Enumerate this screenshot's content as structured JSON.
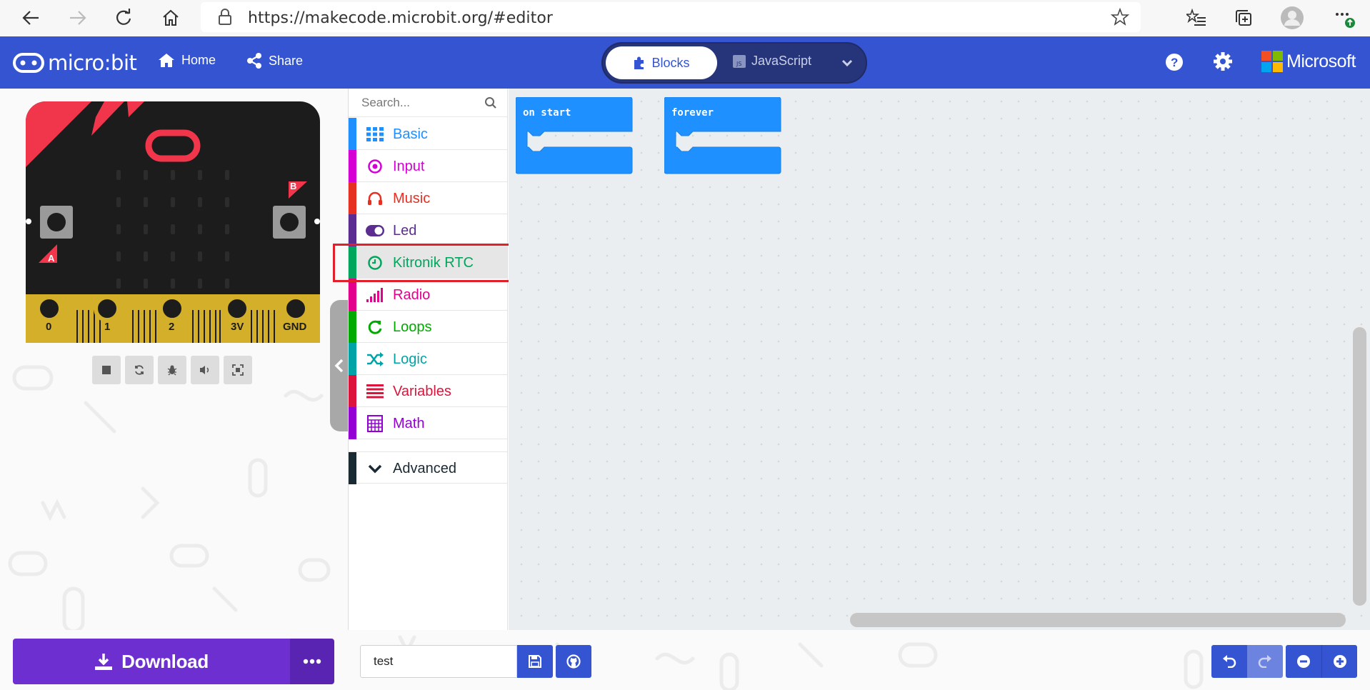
{
  "browser": {
    "url": "https://makecode.microbit.org/#editor"
  },
  "header": {
    "logo_text": "micro:bit",
    "home_label": "Home",
    "share_label": "Share",
    "blocks_label": "Blocks",
    "javascript_label": "JavaScript",
    "microsoft_label": "Microsoft"
  },
  "simulator": {
    "pins": [
      "0",
      "1",
      "2",
      "3V",
      "GND"
    ],
    "button_a": "A",
    "button_b": "B"
  },
  "toolbox": {
    "search_placeholder": "Search...",
    "categories": [
      {
        "label": "Basic",
        "color": "#1e90ff",
        "icon": "grid-icon"
      },
      {
        "label": "Input",
        "color": "#d400d4",
        "icon": "target-icon"
      },
      {
        "label": "Music",
        "color": "#e63022",
        "icon": "headphones-icon"
      },
      {
        "label": "Led",
        "color": "#5c2d91",
        "icon": "toggle-icon"
      },
      {
        "label": "Kitronik RTC",
        "color": "#00a65c",
        "icon": "clock-icon"
      },
      {
        "label": "Radio",
        "color": "#e3008c",
        "icon": "signal-icon"
      },
      {
        "label": "Loops",
        "color": "#00aa00",
        "icon": "refresh-icon"
      },
      {
        "label": "Logic",
        "color": "#00a4a6",
        "icon": "shuffle-icon"
      },
      {
        "label": "Variables",
        "color": "#dc143c",
        "icon": "list-icon"
      },
      {
        "label": "Math",
        "color": "#9400d3",
        "icon": "calculator-icon"
      }
    ],
    "advanced_label": "Advanced"
  },
  "workspace": {
    "blocks": [
      {
        "label": "on start",
        "color": "#1e90ff"
      },
      {
        "label": "forever",
        "color": "#1e90ff"
      }
    ]
  },
  "bottom": {
    "download_label": "Download",
    "project_name": "test"
  },
  "colors": {
    "header_blue": "#3454d1",
    "download_purple": "#6e2fd1",
    "highlight_red": "#e0202a"
  }
}
